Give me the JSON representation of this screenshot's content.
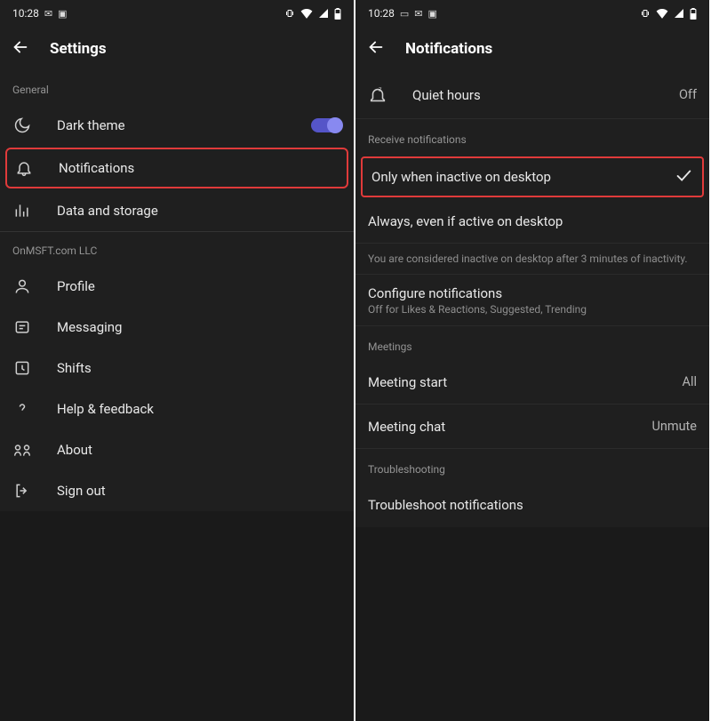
{
  "left": {
    "status": {
      "time": "10:28"
    },
    "appbar": {
      "title": "Settings"
    },
    "section_general": "General",
    "rows": {
      "dark_theme": "Dark theme",
      "notifications": "Notifications",
      "data_storage": "Data and storage"
    },
    "section_org": "OnMSFT.com LLC",
    "rows2": {
      "profile": "Profile",
      "messaging": "Messaging",
      "shifts": "Shifts",
      "help": "Help & feedback",
      "about": "About",
      "signout": "Sign out"
    }
  },
  "right": {
    "status": {
      "time": "10:28"
    },
    "appbar": {
      "title": "Notifications"
    },
    "quiet_hours": {
      "label": "Quiet hours",
      "value": "Off"
    },
    "section_receive": "Receive notifications",
    "opt_inactive": "Only when inactive on desktop",
    "opt_always": "Always, even if active on desktop",
    "inactive_help": "You are considered inactive on desktop after 3 minutes of inactivity.",
    "configure": {
      "primary": "Configure notifications",
      "secondary": "Off for Likes & Reactions, Suggested, Trending"
    },
    "section_meetings": "Meetings",
    "meeting_start": {
      "label": "Meeting start",
      "value": "All"
    },
    "meeting_chat": {
      "label": "Meeting chat",
      "value": "Unmute"
    },
    "section_trouble": "Troubleshooting",
    "troubleshoot": "Troubleshoot notifications"
  }
}
